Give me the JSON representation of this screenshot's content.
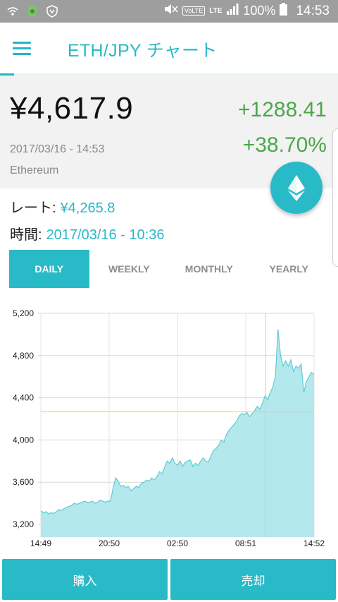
{
  "status_bar": {
    "battery": "100%",
    "time": "14:53",
    "network": "LTE",
    "volte": "VoLTE",
    "icons": [
      "wifi-calling-icon",
      "android-icon",
      "shield-icon",
      "mute-icon",
      "volte-icon",
      "lte-icon",
      "signal-icon",
      "battery-icon"
    ]
  },
  "appbar": {
    "title": "ETH/JPY チャート"
  },
  "price": {
    "current": "¥4,617.9",
    "timestamp": "2017/03/16 - 14:53",
    "name": "Ethereum",
    "change_abs": "+1288.41",
    "change_pct": "+38.70%"
  },
  "rate": {
    "label": "レート:",
    "value": "¥4,265.8"
  },
  "time": {
    "label": "時間:",
    "value": "2017/03/16 - 10:36"
  },
  "tabs": [
    "DAILY",
    "WEEKLY",
    "MONTHLY",
    "YEARLY"
  ],
  "active_tab": "DAILY",
  "colors": {
    "accent": "#29bac8",
    "positive": "#4ca64c",
    "area_fill": "#b3e8ec",
    "crosshair": "#f3c58d"
  },
  "chart_data": {
    "type": "area",
    "ylim": [
      3150,
      5200
    ],
    "yticks": [
      3200,
      3600,
      4000,
      4400,
      4800,
      5200
    ],
    "ytick_labels": [
      "3,200",
      "3,600",
      "4,000",
      "4,400",
      "4,800",
      "5,200"
    ],
    "xtick_labels": [
      "14:49",
      "20:50",
      "02:50",
      "08:51",
      "14:52"
    ],
    "crosshair": {
      "x_label": "10:36",
      "y_value": 4265.8
    },
    "series": [
      {
        "values": [
          3330,
          3310,
          3320,
          3300,
          3310,
          3305,
          3320,
          3340,
          3330,
          3350,
          3360,
          3370,
          3380,
          3400,
          3390,
          3400,
          3410,
          3420,
          3410,
          3410,
          3420,
          3400,
          3410,
          3430,
          3420,
          3410,
          3420,
          3420,
          3540,
          3640,
          3610,
          3560,
          3570,
          3550,
          3560,
          3520,
          3540,
          3560,
          3550,
          3590,
          3600,
          3620,
          3610,
          3640,
          3620,
          3650,
          3700,
          3680,
          3740,
          3800,
          3780,
          3830,
          3780,
          3760,
          3800,
          3750,
          3790,
          3800,
          3810,
          3750,
          3780,
          3760,
          3800,
          3830,
          3800,
          3790,
          3850,
          3900,
          3920,
          3950,
          4000,
          3980,
          4050,
          4090,
          4120,
          4150,
          4180,
          4230,
          4250,
          4240,
          4260,
          4220,
          4250,
          4280,
          4320,
          4290,
          4350,
          4420,
          4380,
          4450,
          4500,
          4600,
          5050,
          4800,
          4700,
          4750,
          4700,
          4760,
          4650,
          4700,
          4680,
          4720,
          4450,
          4550,
          4600,
          4640,
          4620
        ]
      }
    ]
  },
  "buttons": {
    "buy": "購入",
    "sell": "売却"
  }
}
